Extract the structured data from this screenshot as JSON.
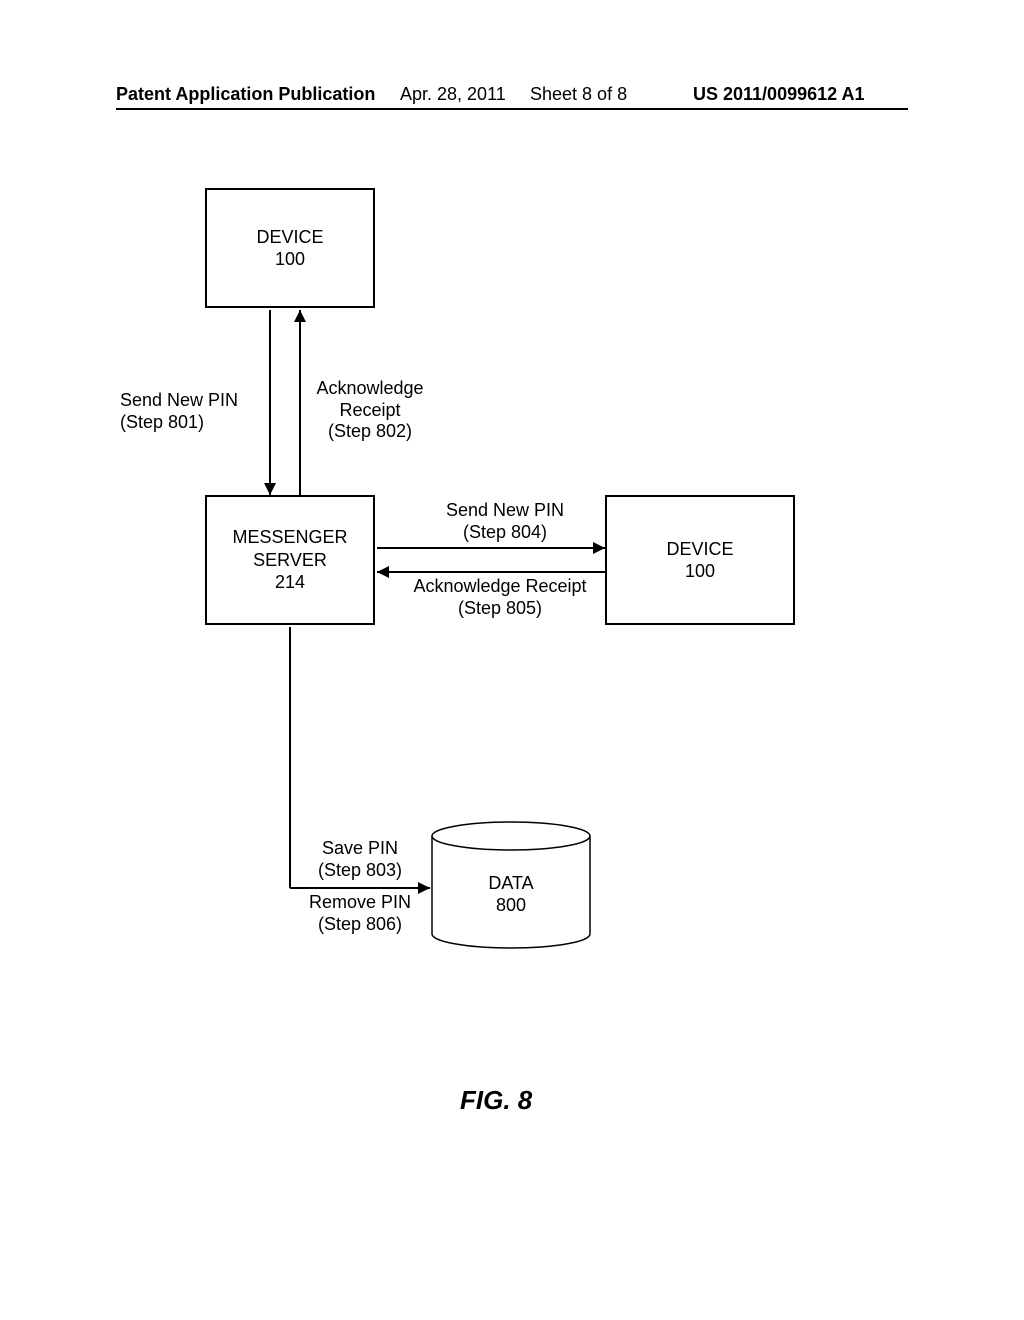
{
  "header": {
    "publication": "Patent Application Publication",
    "date": "Apr. 28, 2011",
    "sheet": "Sheet 8 of 8",
    "pubnum": "US 2011/0099612 A1"
  },
  "boxes": {
    "device_top": {
      "title": "DEVICE",
      "num": "100"
    },
    "messenger": {
      "title": "MESSENGER",
      "sub": "SERVER",
      "num": "214"
    },
    "device_right": {
      "title": "DEVICE",
      "num": "100"
    },
    "data": {
      "title": "DATA",
      "num": "800"
    }
  },
  "labels": {
    "send_pin_801_l1": "Send New PIN",
    "send_pin_801_l2": "(Step 801)",
    "ack_802_l1": "Acknowledge",
    "ack_802_l2": "Receipt",
    "ack_802_l3": "(Step 802)",
    "send_pin_804_l1": "Send New PIN",
    "send_pin_804_l2": "(Step 804)",
    "ack_805_l1": "Acknowledge Receipt",
    "ack_805_l2": "(Step 805)",
    "save_803_l1": "Save PIN",
    "save_803_l2": "(Step 803)",
    "remove_806_l1": "Remove PIN",
    "remove_806_l2": "(Step 806)"
  },
  "figure": {
    "caption": "FIG. 8"
  }
}
